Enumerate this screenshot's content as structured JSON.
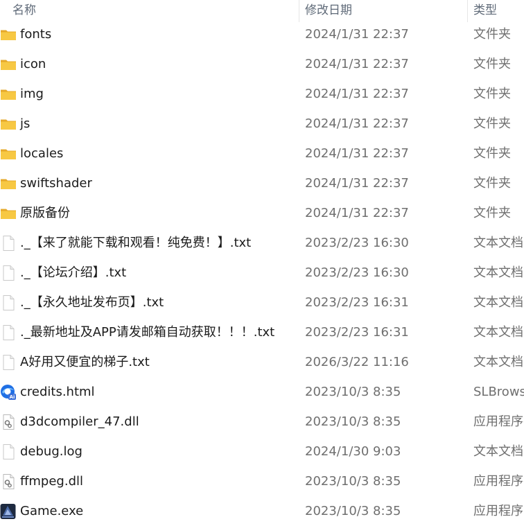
{
  "header": {
    "name_label": "名称",
    "date_label": "修改日期",
    "type_label": "类型",
    "sort_indicator": "^"
  },
  "files": [
    {
      "name": "fonts",
      "date": "2024/1/31 22:37",
      "type": "文件夹",
      "icon": "folder-icon"
    },
    {
      "name": "icon",
      "date": "2024/1/31 22:37",
      "type": "文件夹",
      "icon": "folder-icon"
    },
    {
      "name": "img",
      "date": "2024/1/31 22:37",
      "type": "文件夹",
      "icon": "folder-icon"
    },
    {
      "name": "js",
      "date": "2024/1/31 22:37",
      "type": "文件夹",
      "icon": "folder-icon"
    },
    {
      "name": "locales",
      "date": "2024/1/31 22:37",
      "type": "文件夹",
      "icon": "folder-icon"
    },
    {
      "name": "swiftshader",
      "date": "2024/1/31 22:37",
      "type": "文件夹",
      "icon": "folder-icon"
    },
    {
      "name": "原版备份",
      "date": "2024/1/31 22:37",
      "type": "文件夹",
      "icon": "folder-icon"
    },
    {
      "name": "._【来了就能下载和观看！纯免费！】.txt",
      "date": "2023/2/23 16:30",
      "type": "文本文档",
      "icon": "text-file-icon"
    },
    {
      "name": "._【论坛介绍】.txt",
      "date": "2023/2/23 16:30",
      "type": "文本文档",
      "icon": "text-file-icon"
    },
    {
      "name": "._【永久地址发布页】.txt",
      "date": "2023/2/23 16:31",
      "type": "文本文档",
      "icon": "text-file-icon"
    },
    {
      "name": "._最新地址及APP请发邮箱自动获取！！！.txt",
      "date": "2023/2/23 16:31",
      "type": "文本文档",
      "icon": "text-file-icon"
    },
    {
      "name": "A好用又便宜的梯子.txt",
      "date": "2026/3/22 11:16",
      "type": "文本文档",
      "icon": "text-file-icon"
    },
    {
      "name": "credits.html",
      "date": "2023/10/3 8:35",
      "type": "SLBrowser",
      "icon": "browser-html-icon"
    },
    {
      "name": "d3dcompiler_47.dll",
      "date": "2023/10/3 8:35",
      "type": "应用程序扩展",
      "icon": "dll-file-icon"
    },
    {
      "name": "debug.log",
      "date": "2024/1/30 9:03",
      "type": "文本文档",
      "icon": "text-file-icon"
    },
    {
      "name": "ffmpeg.dll",
      "date": "2023/10/3 8:35",
      "type": "应用程序扩展",
      "icon": "dll-file-icon"
    },
    {
      "name": "Game.exe",
      "date": "2023/10/3 8:35",
      "type": "应用程序",
      "icon": "exe-app-icon"
    }
  ],
  "colors": {
    "folder": "#f7c843",
    "folder_dark": "#e6a92a",
    "browser_blue": "#1f6fe5",
    "exe_dark": "#2b3a55"
  }
}
